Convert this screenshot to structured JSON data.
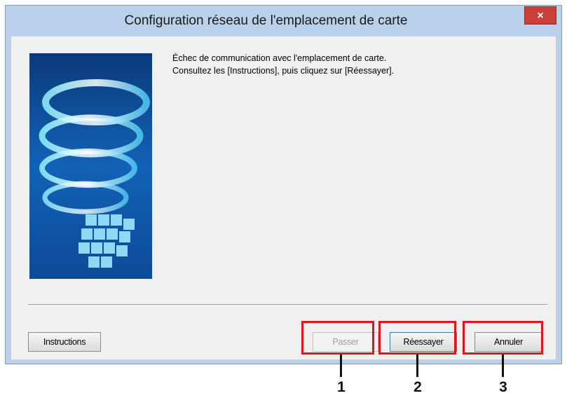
{
  "dialog": {
    "title": "Configuration réseau de l'emplacement de carte",
    "close_label": "×",
    "message_line1": "Échec de communication avec l'emplacement de carte.",
    "message_line2": "Consultez les [Instructions], puis cliquez sur [Réessayer]."
  },
  "buttons": {
    "instructions": "Instructions",
    "skip": "Passer",
    "retry": "Réessayer",
    "cancel": "Annuler"
  },
  "callouts": [
    "1",
    "2",
    "3"
  ],
  "colors": {
    "frame": "#b9d1ea",
    "close": "#c7403a",
    "callout": "#e0161e",
    "client": "#f0f0f0"
  }
}
